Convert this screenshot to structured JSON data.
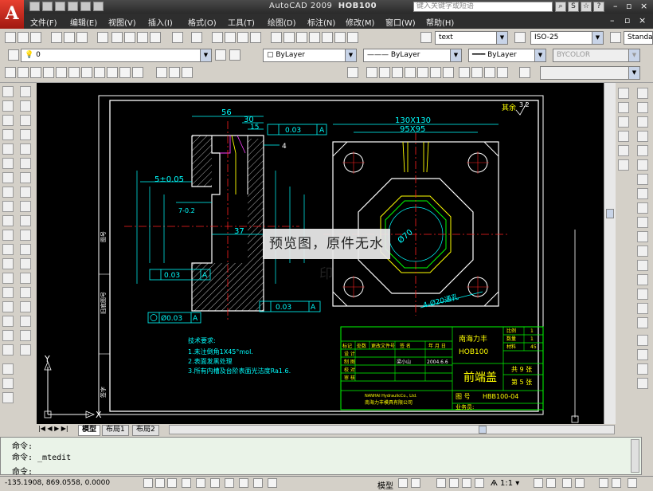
{
  "app": {
    "title_app": "AutoCAD 2009",
    "title_file": "HOB100",
    "search_placeholder": "键入关键字或短语",
    "logo_letter": "A"
  },
  "menu": [
    "文件(F)",
    "编辑(E)",
    "视图(V)",
    "插入(I)",
    "格式(O)",
    "工具(T)",
    "绘图(D)",
    "标注(N)",
    "修改(M)",
    "窗口(W)",
    "帮助(H)"
  ],
  "styles": {
    "text_style": "text",
    "dim_style": "ISO-25",
    "table_style": "Standar"
  },
  "layers": {
    "current_layer": "0",
    "color": "ByLayer",
    "linetype": "ByLayer",
    "lineweight": "ByLayer",
    "plotstyle": "BYCOLOR"
  },
  "layout_tabs": [
    "模型",
    "布局1",
    "布局2"
  ],
  "command": {
    "line1": "命令:",
    "line2": "命令:  _mtedit",
    "line3": "命令:"
  },
  "status": {
    "coords": "-135.1908, 869.0558, 0.0000",
    "model_label": "模型",
    "scale": "1:1"
  },
  "drawing": {
    "roughness_label": "其余",
    "roughness_value": "3.2",
    "dim_56": "56",
    "dim_30": "30",
    "dim_15": "15",
    "dim_4": "4",
    "dim_37": "37",
    "dim_5": "5±0.05",
    "dim_7": "7-0.2",
    "dim_130": "130X130",
    "dim_95": "95X95",
    "dim_d70": "Ø70",
    "dim_holes": "4-Ø20通孔",
    "tol_top": "0.03",
    "tol_top_ref": "A",
    "tol_left": "0.03",
    "tol_left_ref": "A",
    "tol_bot": "0.03",
    "tol_bot_ref": "A",
    "tol_circ": "Ø0.03",
    "tol_circ_ref": "A",
    "side_label_1": "图号",
    "side_label_2": "旧底图号",
    "side_label_3": "签字",
    "tech_title": "技术要求:",
    "tech_1": "1.未注倒角1X45°mol.",
    "tech_2": "2.表面发黑处理",
    "tech_3": "3.所有内槽及台阶表面光洁度Ra1.6.",
    "tb_company": "南海力丰",
    "tb_model": "HOB100",
    "tb_part": "前端盖",
    "tb_drawing_no": "HBB100-04",
    "tb_drawing_no_label": "图 号",
    "tb_total": "共 9 张",
    "tb_sheet": "第 5 张",
    "tb_material": "材料",
    "tb_qty_label": "数量",
    "tb_qty": "1",
    "tb_mat_label": "材料",
    "tb_mat": "45",
    "tb_weight_label": "比例",
    "tb_weight": "1",
    "tb_company_full": "南海力丰模具有限公司",
    "tb_company_en": "NANHAI HydraulicCo., Ltd.",
    "tb_owner_label": "业务员:",
    "tb_date": "2004.6.6",
    "tb_designer": "梁小山",
    "tb_row_design": "设 计",
    "tb_row_draw": "制 图",
    "tb_row_check": "校 对",
    "tb_row_approve": "审 核",
    "tb_head_mark": "标记",
    "tb_head_count": "处数",
    "tb_head_file": "更改文件号",
    "tb_head_sign": "签 名",
    "tb_head_date": "年 月 日"
  },
  "watermark": "预览图，原件无水印",
  "ucs": {
    "x": "X",
    "y": "Y"
  },
  "colors": {
    "canvas_bg": "#000000",
    "line_white": "#ffffff",
    "line_cyan": "#00ffff",
    "line_green": "#00ff00",
    "line_red": "#ff2020",
    "line_yellow": "#ffff00",
    "line_magenta": "#ff40ff"
  }
}
